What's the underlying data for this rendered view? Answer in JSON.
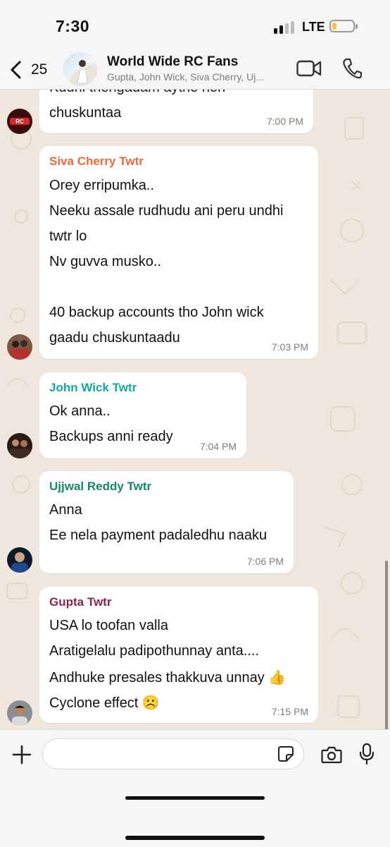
{
  "status": {
    "time": "7:30",
    "network": "LTE",
    "battery_color": "#f2c94c"
  },
  "header": {
    "back_count": "25",
    "title": "World Wide RC Fans",
    "subtitle": "Gupta, John Wick, Siva Cherry, Uj...",
    "icons": [
      "chevron-left-icon",
      "video-call-icon",
      "phone-icon"
    ]
  },
  "messages": [
    {
      "sender": "",
      "sender_color": "",
      "lines": [
        "Kudhi thengadam aythe nen",
        "chuskuntaa"
      ],
      "time": "7:00 PM"
    },
    {
      "sender": "Siva Cherry Twtr",
      "sender_color": "#e9693b",
      "lines": [
        "Orey erripumka..",
        "Neeku assale rudhudu ani peru undhi",
        "twtr lo",
        "Nv guvva musko..",
        "",
        "40 backup accounts tho John wick",
        "gaadu chuskuntaadu"
      ],
      "time": "7:03 PM"
    },
    {
      "sender": "John Wick Twtr",
      "sender_color": "#13a89e",
      "lines": [
        "Ok anna..",
        "Backups anni ready"
      ],
      "time": "7:04 PM"
    },
    {
      "sender": "Ujjwal Reddy Twtr",
      "sender_color": "#128a64",
      "lines": [
        "Anna",
        "Ee nela payment padaledhu naaku"
      ],
      "time": "7:06 PM"
    },
    {
      "sender": "Gupta Twtr",
      "sender_color": "#8b2252",
      "lines": [
        "USA lo toofan valla",
        "Aratigelalu padipothunnay anta....",
        "Andhuke presales thakkuva unnay 👍",
        "Cyclone effect ☹️"
      ],
      "time": "7:15 PM"
    }
  ],
  "input": {
    "placeholder": "",
    "value": ""
  },
  "input_icons": [
    "plus-icon",
    "sticker-icon",
    "camera-icon",
    "microphone-icon"
  ]
}
